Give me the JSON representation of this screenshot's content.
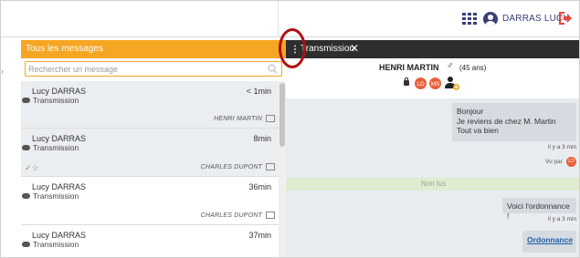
{
  "header": {
    "user_name": "DARRAS LUCY",
    "grid_color": "#3a3f7a",
    "logout_color": "#e8463c"
  },
  "left_panel": {
    "title": "Tous les messages",
    "search_placeholder": "Rechercher un message",
    "accent": "#f5a623",
    "messages": [
      {
        "sender": "Lucy DARRAS",
        "kind": "Transmission",
        "time": "< 1min",
        "author": "HENRI MARTIN",
        "has_checks": false
      },
      {
        "sender": "Lucy DARRAS",
        "kind": "Transmission",
        "time": "8min",
        "author": "CHARLES DUPONT",
        "has_checks": true
      },
      {
        "sender": "Lucy DARRAS",
        "kind": "Transmission",
        "time": "36min",
        "author": "CHARLES DUPONT",
        "has_checks": false
      },
      {
        "sender": "Lucy DARRAS",
        "kind": "Transmission",
        "time": "37min",
        "author": "",
        "has_checks": false
      }
    ],
    "checks_glyph": "✓☆"
  },
  "right_panel": {
    "title": "Transmission",
    "close_glyph": "✕",
    "kebab_glyph": "⋮",
    "patient": {
      "name": "HENRI MARTIN",
      "gender_symbol": "♂",
      "age": "(45 ans)",
      "badges": [
        "LD",
        "MS"
      ]
    },
    "conversation": {
      "message1": {
        "lines": [
          "Bonjour",
          "Je reviens de chez M. Martin",
          "Tout va bien"
        ],
        "time": "il y a 3 min",
        "seen_by": "Vu par",
        "seen_badge": "LD"
      },
      "unread_label": "Non lus",
      "message2": {
        "text": "Voici l'ordonnance !",
        "time": "il y a 3 min"
      },
      "link_label": "Ordonnance"
    }
  }
}
